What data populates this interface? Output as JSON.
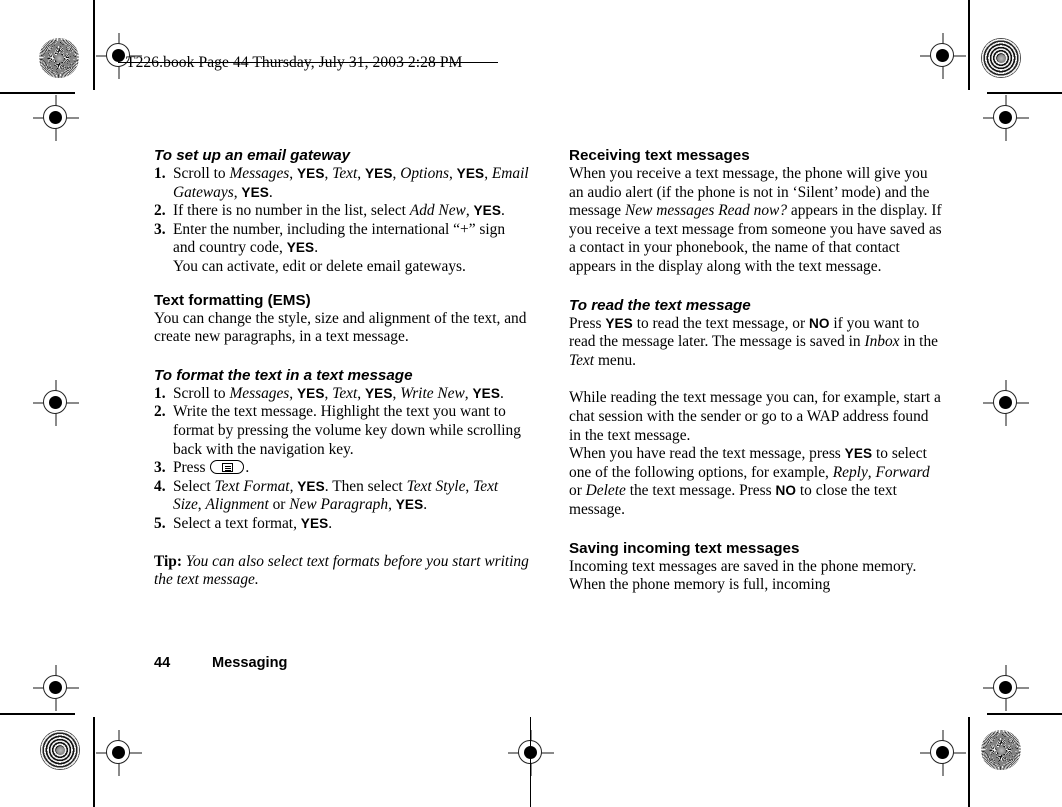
{
  "header": {
    "text": "T226.book  Page 44  Thursday, July 31, 2003  2:28 PM"
  },
  "footer": {
    "page_number": "44",
    "section": "Messaging"
  },
  "left_column": {
    "sub_heading_1": "To set up an email gateway",
    "steps_1": [
      {
        "num": "1.",
        "parts": [
          {
            "t": " Scroll to ",
            "s": "n"
          },
          {
            "t": "Messages",
            "s": "i"
          },
          {
            "t": ", ",
            "s": "n"
          },
          {
            "t": "YES",
            "s": "k"
          },
          {
            "t": ", ",
            "s": "n"
          },
          {
            "t": "Text",
            "s": "i"
          },
          {
            "t": ", ",
            "s": "n"
          },
          {
            "t": "YES",
            "s": "k"
          },
          {
            "t": ", ",
            "s": "n"
          },
          {
            "t": "Options",
            "s": "i"
          },
          {
            "t": ", ",
            "s": "n"
          },
          {
            "t": "YES",
            "s": "k"
          },
          {
            "t": ", ",
            "s": "n"
          },
          {
            "t": "Email Gateways",
            "s": "i"
          },
          {
            "t": ", ",
            "s": "n"
          },
          {
            "t": "YES",
            "s": "k"
          },
          {
            "t": ".",
            "s": "n"
          }
        ]
      },
      {
        "num": "2.",
        "parts": [
          {
            "t": "If there is no number in the list, select ",
            "s": "n"
          },
          {
            "t": "Add New",
            "s": "i"
          },
          {
            "t": ", ",
            "s": "n"
          },
          {
            "t": "YES",
            "s": "k"
          },
          {
            "t": ".",
            "s": "n"
          }
        ]
      },
      {
        "num": "3.",
        "parts": [
          {
            "t": "Enter the number, including the international “+” sign and country code, ",
            "s": "n"
          },
          {
            "t": "YES",
            "s": "k"
          },
          {
            "t": ".",
            "s": "n"
          },
          {
            "t": "\nYou can activate, edit or delete email gateways.",
            "s": "n"
          }
        ]
      }
    ],
    "heading_1": "Text formatting (EMS)",
    "para_1": "You can change the style, size and alignment of the text, and create new paragraphs, in a text message.",
    "sub_heading_2": "To format the text in a text message",
    "steps_2": [
      {
        "num": "1.",
        "parts": [
          {
            "t": "Scroll to ",
            "s": "n"
          },
          {
            "t": "Messages",
            "s": "i"
          },
          {
            "t": ", ",
            "s": "n"
          },
          {
            "t": "YES",
            "s": "k"
          },
          {
            "t": ", ",
            "s": "n"
          },
          {
            "t": "Text",
            "s": "i"
          },
          {
            "t": ", ",
            "s": "n"
          },
          {
            "t": "YES",
            "s": "k"
          },
          {
            "t": ", ",
            "s": "n"
          },
          {
            "t": "Write New",
            "s": "i"
          },
          {
            "t": ", ",
            "s": "n"
          },
          {
            "t": "YES",
            "s": "k"
          },
          {
            "t": ".",
            "s": "n"
          }
        ]
      },
      {
        "num": "2.",
        "parts": [
          {
            "t": "Write the text message. Highlight the text you want to format by pressing the volume key down while scrolling back with the navigation key.",
            "s": "n"
          }
        ]
      },
      {
        "num": "3.",
        "parts": [
          {
            "t": "Press ",
            "s": "n"
          },
          {
            "t": "",
            "s": "glyph"
          },
          {
            "t": ".",
            "s": "n"
          }
        ]
      },
      {
        "num": "4.",
        "parts": [
          {
            "t": "Select ",
            "s": "n"
          },
          {
            "t": "Text Format",
            "s": "i"
          },
          {
            "t": ", ",
            "s": "n"
          },
          {
            "t": "YES",
            "s": "k"
          },
          {
            "t": ". Then select ",
            "s": "n"
          },
          {
            "t": "Text Style",
            "s": "i"
          },
          {
            "t": ", ",
            "s": "n"
          },
          {
            "t": "Text Size",
            "s": "i"
          },
          {
            "t": ", ",
            "s": "n"
          },
          {
            "t": "Alignment",
            "s": "i"
          },
          {
            "t": " or ",
            "s": "n"
          },
          {
            "t": "New Paragraph",
            "s": "i"
          },
          {
            "t": ", ",
            "s": "n"
          },
          {
            "t": "YES",
            "s": "k"
          },
          {
            "t": ".",
            "s": "n"
          }
        ]
      },
      {
        "num": "5.",
        "parts": [
          {
            "t": "Select a text format, ",
            "s": "n"
          },
          {
            "t": "YES",
            "s": "k"
          },
          {
            "t": ".",
            "s": "n"
          }
        ]
      }
    ],
    "tip": {
      "label": "Tip:",
      "text": " You can also select text formats before you start writing the text message."
    }
  },
  "right_column": {
    "heading_1": "Receiving text messages",
    "para_1_parts": [
      {
        "t": "When you receive a text message, the phone will give you an audio alert (if the phone is not in ‘Silent’ mode) and the message ",
        "s": "n"
      },
      {
        "t": "New messages Read now?",
        "s": "i"
      },
      {
        "t": " appears in the display. If you receive a text message from someone you have saved as a contact in your phonebook, the name of that contact appears in the display along with the text message.",
        "s": "n"
      }
    ],
    "sub_heading_1": "To read the text message",
    "para_2_parts": [
      {
        "t": "Press ",
        "s": "n"
      },
      {
        "t": "YES",
        "s": "k"
      },
      {
        "t": " to read the text message, or ",
        "s": "n"
      },
      {
        "t": "NO",
        "s": "k"
      },
      {
        "t": " if you want to read the message later. The message is saved in ",
        "s": "n"
      },
      {
        "t": "Inbox",
        "s": "i"
      },
      {
        "t": " in the ",
        "s": "n"
      },
      {
        "t": "Text",
        "s": "i"
      },
      {
        "t": " menu.",
        "s": "n"
      }
    ],
    "para_3_parts": [
      {
        "t": "While reading the text message you can, for example, start a chat session with the sender or go to a WAP address found in the text message.",
        "s": "n"
      }
    ],
    "para_4_parts": [
      {
        "t": "When you have read the text message, press ",
        "s": "n"
      },
      {
        "t": "YES",
        "s": "k"
      },
      {
        "t": " to select one of the following options, for example, ",
        "s": "n"
      },
      {
        "t": "Reply",
        "s": "i"
      },
      {
        "t": ", ",
        "s": "n"
      },
      {
        "t": "Forward",
        "s": "i"
      },
      {
        "t": " or ",
        "s": "n"
      },
      {
        "t": "Delete",
        "s": "i"
      },
      {
        "t": " the text message. Press ",
        "s": "n"
      },
      {
        "t": "NO",
        "s": "k"
      },
      {
        "t": " to close the text message.",
        "s": "n"
      }
    ],
    "heading_2": "Saving incoming text messages",
    "para_5": "Incoming text messages are saved in the phone memory. When the phone memory is full, incoming"
  },
  "marks": {
    "registration": "registration-crosshair",
    "star": "star-target",
    "rings": "rings-target"
  }
}
